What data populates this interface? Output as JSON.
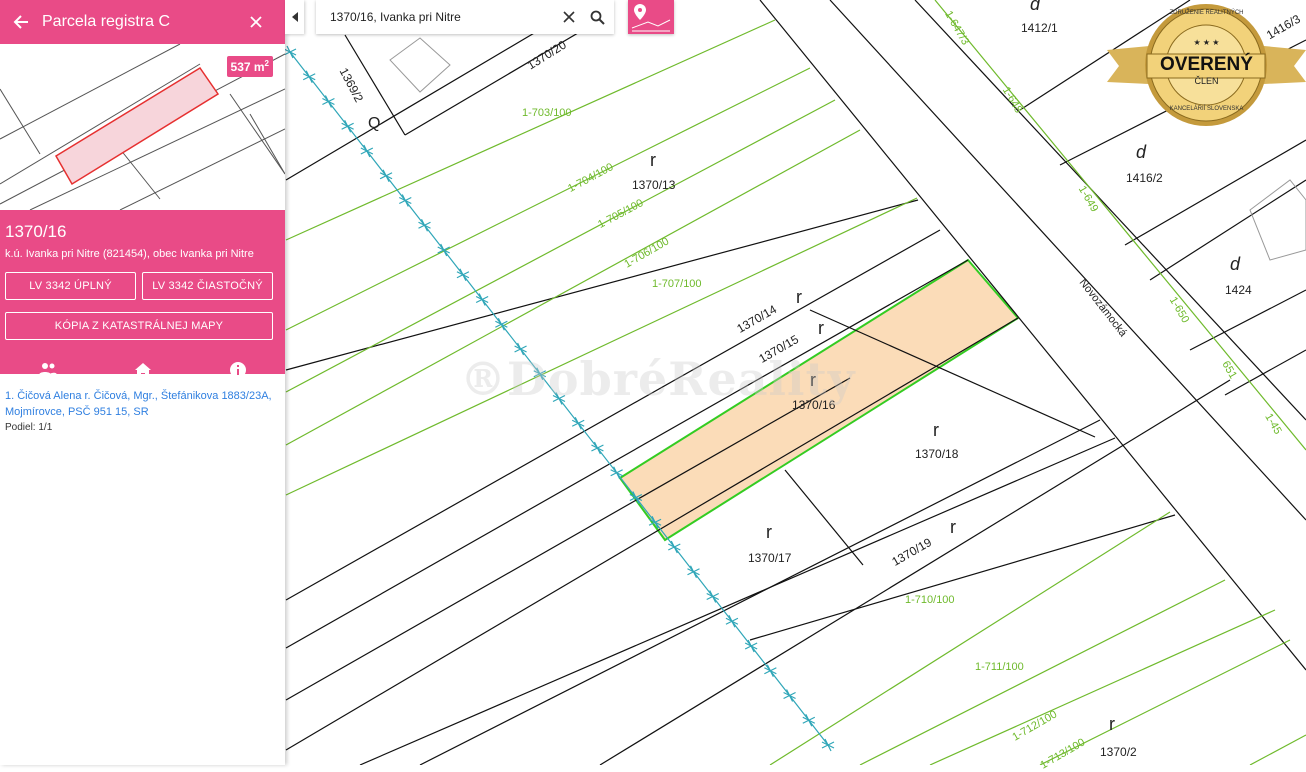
{
  "sidebar": {
    "title": "Parcela registra C",
    "area_value": "537 m",
    "area_unit_sup": "2",
    "parcel_number": "1370/16",
    "cadastral_info": "k.ú. Ivanka pri Nitre (821454), obec Ivanka pri Nitre",
    "buttons": {
      "lv_full": "LV 3342 úplný",
      "lv_partial": "LV 3342 čiastočný",
      "map_copy": "Kópia z katastrálnej mapy"
    },
    "tabs": [
      "owners-tab",
      "building-tab",
      "info-tab"
    ],
    "owner": {
      "line": "1. Čičová Alena r. Čičová, Mgr., Štefánikova 1883/23A, Mojmírovce, PSČ 951 15, SR",
      "share": "Podiel: 1/1"
    }
  },
  "search": {
    "value": "1370/16, Ivanka pri Nitre"
  },
  "badge": {
    "ring_top": "ZDRUŽENIE REALITNÝCH",
    "ring_bottom": "KANCELÁRIÍ SLOVENSKA",
    "main": "OVERENÝ",
    "sub": "ČLEN",
    "stars": "★ ★ ★"
  },
  "watermark": "®DobréReality",
  "map": {
    "street": "Novozámocká",
    "parcel_labels": {
      "p1370_20": "1370/20",
      "p1369_2": "1369/2",
      "p1370_13": "1370/13",
      "p1370_14": "1370/14",
      "p1370_15": "1370/15",
      "p1370_16": "1370/16",
      "p1370_17": "1370/17",
      "p1370_18": "1370/18",
      "p1370_19": "1370/19",
      "p1370_2": "1370/2",
      "p1412_1": "1412/1",
      "p1416_2": "1416/2",
      "p1416_3": "1416/3",
      "p1424": "1424"
    },
    "green_labels": {
      "g703": "1-703/100",
      "g704": "1-704/100",
      "g705": "1-705/100",
      "g706": "1-706/100",
      "g707": "1-707/100",
      "g710": "1-710/100",
      "g711": "1-711/100",
      "g712": "1-712/100",
      "g713": "1-713/100",
      "g647": "1-647/3",
      "g648": "1-648",
      "g649": "1-649",
      "g650": "1-650",
      "g651": "651",
      "g145": "1-45"
    },
    "symbols": {
      "r": "r",
      "d": "d",
      "q": "Q"
    }
  }
}
